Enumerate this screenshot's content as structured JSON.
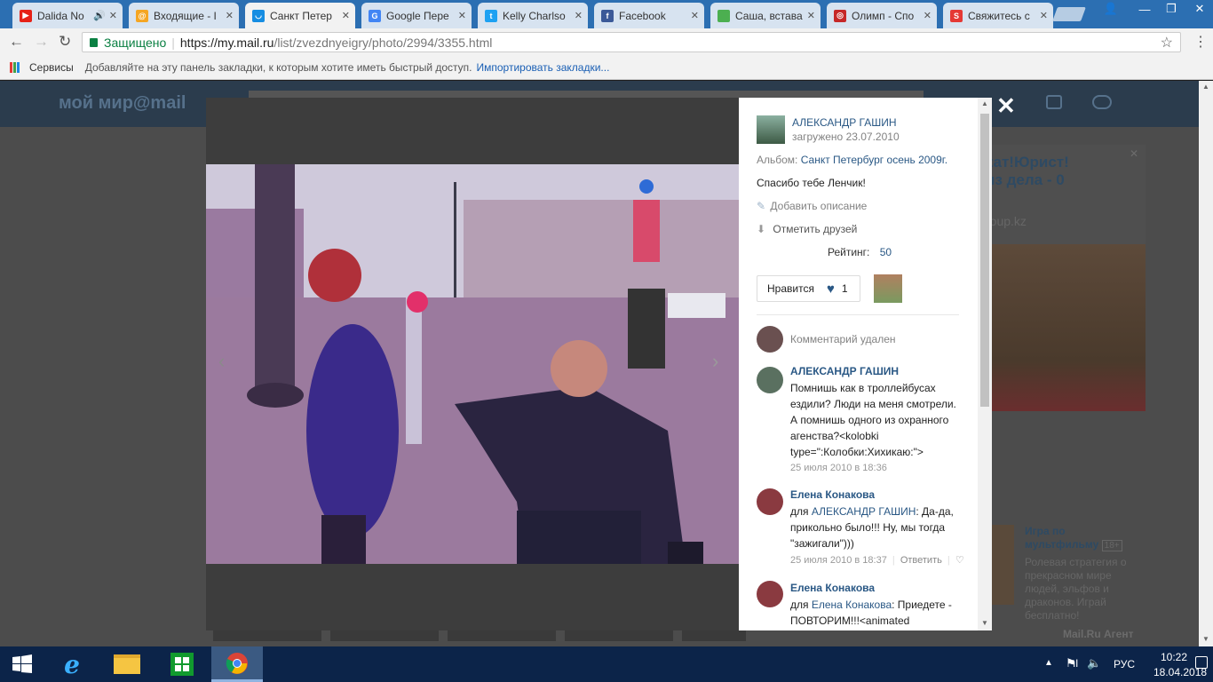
{
  "browser": {
    "tabs": [
      {
        "title": "Dalida No",
        "fav_color": "#e62117",
        "fav": "▶"
      },
      {
        "title": "Входящие - I",
        "fav_color": "#f5a623",
        "fav": "@"
      },
      {
        "title": "Санкт Петер",
        "fav_color": "#168de2",
        "fav": "◡"
      },
      {
        "title": "Google Пере",
        "fav_color": "#4285f4",
        "fav": "G"
      },
      {
        "title": "Kelly Charlso",
        "fav_color": "#1da1f2",
        "fav": "t"
      },
      {
        "title": "Facebook",
        "fav_color": "#3b5998",
        "fav": "f"
      },
      {
        "title": "Саша, встава",
        "fav_color": "#4caf50",
        "fav": ""
      },
      {
        "title": "Олимп - Спо",
        "fav_color": "#c62828",
        "fav": "◎"
      },
      {
        "title": "Свяжитесь с",
        "fav_color": "#e53935",
        "fav": "S"
      }
    ],
    "secure_label": "Защищено",
    "url_host": "https://my.mail.ru",
    "url_path": "/list/zvezdnyeigry/photo/2994/3355.html",
    "apps_label": "Сервисы",
    "bookmarks_hint": "Добавляйте на эту панель закладки, к которым хотите иметь быстрый доступ.",
    "import_label": "Импортировать закладки..."
  },
  "site": {
    "logo": "мой мир@mail",
    "ad_title_1": "кат!Юрист!",
    "ad_title_2": "из дела - 0",
    "ad_domain": "roup.kz",
    "game_title": "Игра по мультфильму",
    "game_age": "18+",
    "game_desc": "Ролевая стратегия о прекрасном мире людей, эльфов и драконов. Играй бесплатно!",
    "agent_label": "Mail.Ru Агент"
  },
  "panel": {
    "author": "АЛЕКСАНДР ГАШИН",
    "uploaded": "загружено 23.07.2010",
    "album_label": "Альбом:",
    "album_name": "Санкт Петербург осень 2009г.",
    "caption": "Спасибо тебе Ленчик!",
    "add_desc": "Добавить описание",
    "tag_friends": "Отметить друзей",
    "rating_label": "Рейтинг:",
    "rating_value": "50",
    "like_label": "Нравится",
    "like_count": "1",
    "comments": [
      {
        "deleted": "Комментарий удален"
      },
      {
        "author": "АЛЕКСАНДР ГАШИН",
        "text": "Помнишь как в троллейбусах ездили? Люди на меня смотрели. А помнишь одного из охранного агенства?<kolobki type=\":Колобки:Хихикаю:\">",
        "date": "25 июля 2010 в 18:36"
      },
      {
        "author": "Елена Конакова",
        "to_prefix": "для",
        "to": "АЛЕКСАНДР ГАШИН",
        "text": ": Да-да, прикольно было!!! Ну, мы тогда \"зажигали\")))",
        "date": "25 июля 2010 в 18:37",
        "reply": "Ответить"
      },
      {
        "author": "Елена Конакова",
        "to_prefix": "для",
        "to": "Елена Конакова",
        "text": ": Приедете - ПОВТОРИМ!!!<animated"
      }
    ]
  },
  "taskbar": {
    "lang": "РУС",
    "time": "10:22",
    "date": "18.04.2018"
  }
}
